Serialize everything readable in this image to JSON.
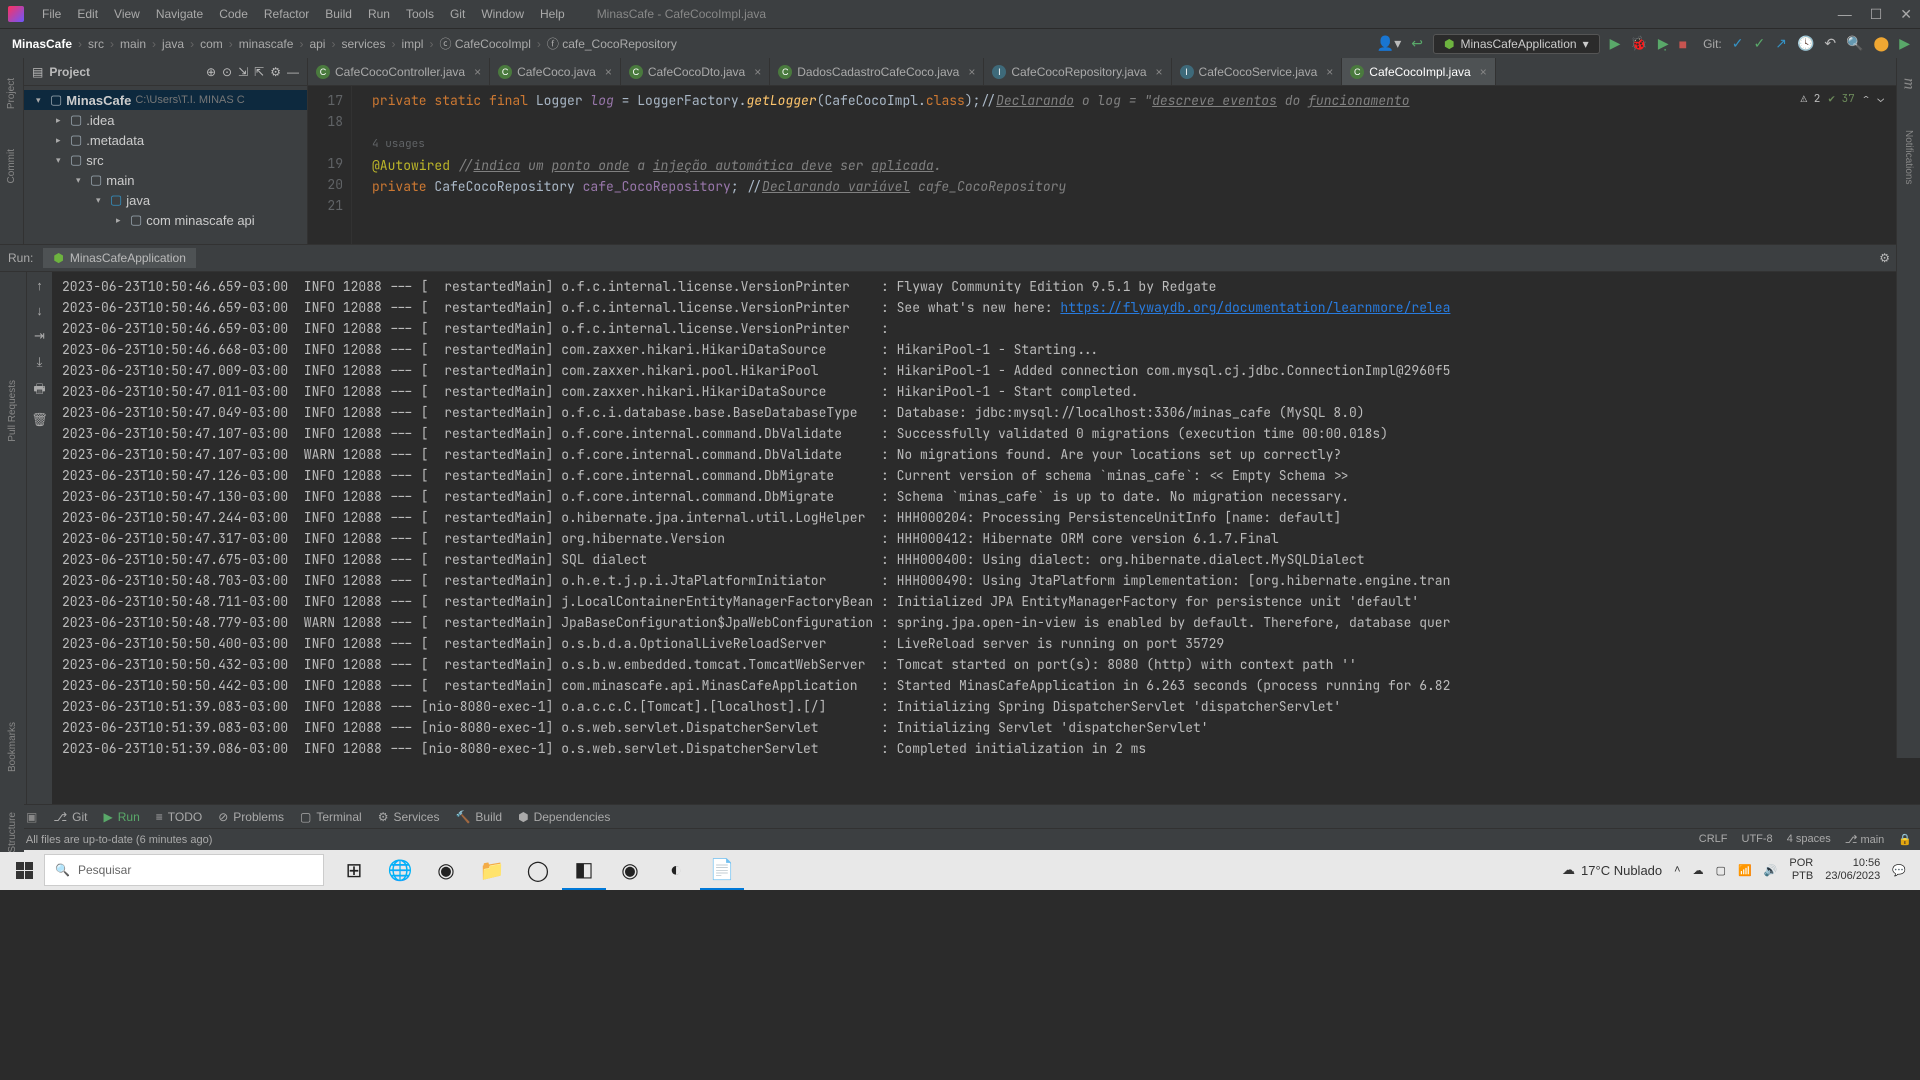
{
  "title": "MinasCafe - CafeCocoImpl.java",
  "menu": [
    "File",
    "Edit",
    "View",
    "Navigate",
    "Code",
    "Refactor",
    "Build",
    "Run",
    "Tools",
    "Git",
    "Window",
    "Help"
  ],
  "breadcrumb": [
    "MinasCafe",
    "src",
    "main",
    "java",
    "com",
    "minascafe",
    "api",
    "services",
    "impl",
    "CafeCocoImpl",
    "cafe_CocoRepository"
  ],
  "run_config": "MinasCafeApplication",
  "git_label": "Git:",
  "project": {
    "title": "Project",
    "root_name": "MinasCafe",
    "root_path": "C:\\Users\\T.I. MINAS C",
    "nodes": [
      ".idea",
      ".metadata",
      "src",
      "main",
      "java",
      "com minascafe api"
    ]
  },
  "editor_tabs": [
    {
      "name": "CafeCocoController.java",
      "kind": "C",
      "active": false
    },
    {
      "name": "CafeCoco.java",
      "kind": "C",
      "active": false
    },
    {
      "name": "CafeCocoDto.java",
      "kind": "C",
      "active": false
    },
    {
      "name": "DadosCadastroCafeCoco.java",
      "kind": "C",
      "active": false
    },
    {
      "name": "CafeCocoRepository.java",
      "kind": "I",
      "active": false
    },
    {
      "name": "CafeCocoService.java",
      "kind": "I",
      "active": false
    },
    {
      "name": "CafeCocoImpl.java",
      "kind": "C",
      "active": true
    }
  ],
  "inspections": {
    "warnings": "2",
    "checks": "37"
  },
  "code": {
    "lines": [
      "17",
      "18",
      "",
      "19",
      "20",
      "21"
    ],
    "hint_usages_4": "4 usages",
    "l17_a": "private ",
    "l17_b": "static ",
    "l17_c": "final ",
    "l17_d": "Logger ",
    "l17_e": "log ",
    "l17_f": "= LoggerFactory.",
    "l17_g": "getLogger",
    "l17_h": "(CafeCocoImpl.",
    "l17_i": "class",
    "l17_j": ");//",
    "l17_k": "Declarando",
    "l17_l": " o log = \"",
    "l17_m": "descreve eventos",
    "l17_n": " do ",
    "l17_o": "funcionamento",
    "l19_a": "@Autowired",
    "l19_b": " //",
    "l19_c": "indica",
    "l19_d": " um ",
    "l19_e": "ponto onde",
    "l19_f": " a ",
    "l19_g": "injeção automática deve",
    "l19_h": " ser ",
    "l19_i": "aplicada",
    "l19_j": ".",
    "l20_a": "private ",
    "l20_b": "CafeCocoRepository ",
    "l20_c": "cafe_CocoRepository",
    "l20_d": "; //",
    "l20_e": "Declarando variável",
    "l20_f": " cafe_CocoRepository"
  },
  "run": {
    "label": "Run:",
    "tab": "MinasCafeApplication",
    "lines": [
      "2023-06-23T10:50:46.659-03:00  INFO 12088 --- [  restartedMain] o.f.c.internal.license.VersionPrinter    : Flyway Community Edition 9.5.1 by Redgate",
      "2023-06-23T10:50:46.659-03:00  INFO 12088 --- [  restartedMain] o.f.c.internal.license.VersionPrinter    : See what's new here: ",
      "2023-06-23T10:50:46.659-03:00  INFO 12088 --- [  restartedMain] o.f.c.internal.license.VersionPrinter    : ",
      "2023-06-23T10:50:46.668-03:00  INFO 12088 --- [  restartedMain] com.zaxxer.hikari.HikariDataSource       : HikariPool-1 - Starting...",
      "2023-06-23T10:50:47.009-03:00  INFO 12088 --- [  restartedMain] com.zaxxer.hikari.pool.HikariPool        : HikariPool-1 - Added connection com.mysql.cj.jdbc.ConnectionImpl@2960f5",
      "2023-06-23T10:50:47.011-03:00  INFO 12088 --- [  restartedMain] com.zaxxer.hikari.HikariDataSource       : HikariPool-1 - Start completed.",
      "2023-06-23T10:50:47.049-03:00  INFO 12088 --- [  restartedMain] o.f.c.i.database.base.BaseDatabaseType   : Database: jdbc:mysql://localhost:3306/minas_cafe (MySQL 8.0)",
      "2023-06-23T10:50:47.107-03:00  INFO 12088 --- [  restartedMain] o.f.core.internal.command.DbValidate     : Successfully validated 0 migrations (execution time 00:00.018s)",
      "2023-06-23T10:50:47.107-03:00  WARN 12088 --- [  restartedMain] o.f.core.internal.command.DbValidate     : No migrations found. Are your locations set up correctly?",
      "2023-06-23T10:50:47.126-03:00  INFO 12088 --- [  restartedMain] o.f.core.internal.command.DbMigrate      : Current version of schema `minas_cafe`: << Empty Schema >>",
      "2023-06-23T10:50:47.130-03:00  INFO 12088 --- [  restartedMain] o.f.core.internal.command.DbMigrate      : Schema `minas_cafe` is up to date. No migration necessary.",
      "2023-06-23T10:50:47.244-03:00  INFO 12088 --- [  restartedMain] o.hibernate.jpa.internal.util.LogHelper  : HHH000204: Processing PersistenceUnitInfo [name: default]",
      "2023-06-23T10:50:47.317-03:00  INFO 12088 --- [  restartedMain] org.hibernate.Version                    : HHH000412: Hibernate ORM core version 6.1.7.Final",
      "2023-06-23T10:50:47.675-03:00  INFO 12088 --- [  restartedMain] SQL dialect                              : HHH000400: Using dialect: org.hibernate.dialect.MySQLDialect",
      "2023-06-23T10:50:48.703-03:00  INFO 12088 --- [  restartedMain] o.h.e.t.j.p.i.JtaPlatformInitiator       : HHH000490: Using JtaPlatform implementation: [org.hibernate.engine.tran",
      "2023-06-23T10:50:48.711-03:00  INFO 12088 --- [  restartedMain] j.LocalContainerEntityManagerFactoryBean : Initialized JPA EntityManagerFactory for persistence unit 'default'",
      "2023-06-23T10:50:48.779-03:00  WARN 12088 --- [  restartedMain] JpaBaseConfiguration$JpaWebConfiguration : spring.jpa.open-in-view is enabled by default. Therefore, database quer",
      "2023-06-23T10:50:50.400-03:00  INFO 12088 --- [  restartedMain] o.s.b.d.a.OptionalLiveReloadServer       : LiveReload server is running on port 35729",
      "2023-06-23T10:50:50.432-03:00  INFO 12088 --- [  restartedMain] o.s.b.w.embedded.tomcat.TomcatWebServer  : Tomcat started on port(s): 8080 (http) with context path ''",
      "2023-06-23T10:50:50.442-03:00  INFO 12088 --- [  restartedMain] com.minascafe.api.MinasCafeApplication   : Started MinasCafeApplication in 6.263 seconds (process running for 6.82",
      "2023-06-23T10:51:39.083-03:00  INFO 12088 --- [nio-8080-exec-1] o.a.c.c.C.[Tomcat].[localhost].[/]       : Initializing Spring DispatcherServlet 'dispatcherServlet'",
      "2023-06-23T10:51:39.083-03:00  INFO 12088 --- [nio-8080-exec-1] o.s.web.servlet.DispatcherServlet        : Initializing Servlet 'dispatcherServlet'",
      "2023-06-23T10:51:39.086-03:00  INFO 12088 --- [nio-8080-exec-1] o.s.web.servlet.DispatcherServlet        : Completed initialization in 2 ms"
    ],
    "link": "https://flywaydb.org/documentation/learnmore/relea"
  },
  "left_tool_tabs": [
    "Project",
    "Commit",
    "Pull Requests"
  ],
  "left_tool_tabs2": [
    "Bookmarks",
    "Structure"
  ],
  "right_tool_tabs": [
    "Maven",
    "Notifications"
  ],
  "bottom_tools": [
    "Git",
    "Run",
    "TODO",
    "Problems",
    "Terminal",
    "Services",
    "Build",
    "Dependencies"
  ],
  "status": {
    "msg": "All files are up-to-date (6 minutes ago)",
    "crlf": "CRLF",
    "enc": "UTF-8",
    "indent": "4 spaces",
    "branch": "main"
  },
  "taskbar": {
    "search": "Pesquisar",
    "weather": "17°C  Nublado",
    "lang1": "POR",
    "lang2": "PTB",
    "time": "10:56",
    "date": "23/06/2023"
  }
}
